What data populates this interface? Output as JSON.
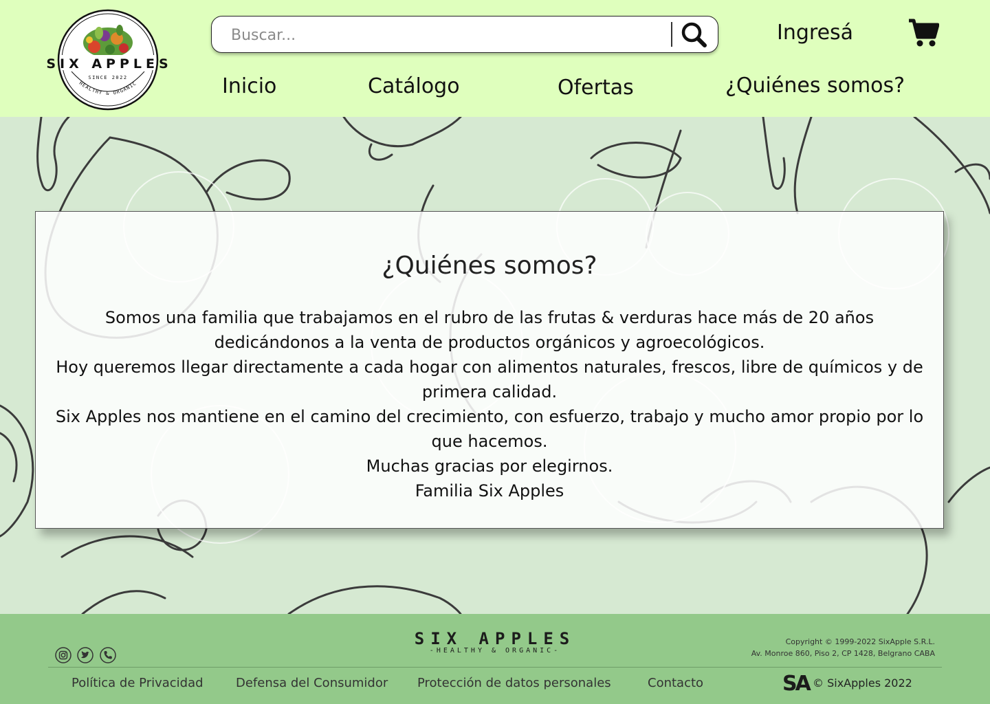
{
  "header": {
    "logo": {
      "brand": "SIX APPLES",
      "since": "SINCE 2022",
      "tagline": "HEALTHY & ORGANIC",
      "icon": "vegetables-basket-logo"
    },
    "search": {
      "placeholder": "Buscar...",
      "value": "",
      "icon": "search-icon"
    },
    "login_label": "Ingresá",
    "cart_icon": "cart-icon",
    "nav": [
      "Inicio",
      "Catálogo",
      "Ofertas",
      "¿Quiénes somos?"
    ]
  },
  "main": {
    "title": "¿Quiénes somos?",
    "paragraphs": [
      "Somos una familia que trabajamos en el rubro de las frutas & verduras hace más de 20 años",
      "dedicándonos a la venta de productos orgánicos y agroecológicos.",
      "Hoy queremos llegar directamente a cada hogar con alimentos naturales, frescos, libre de químicos y de",
      "primera calidad.",
      "Six Apples nos mantiene en el camino del crecimiento, con esfuerzo, trabajo y mucho amor propio por lo",
      "que hacemos.",
      "Muchas gracias por elegirnos.",
      "Familia Six Apples"
    ]
  },
  "footer": {
    "social": [
      "instagram-icon",
      "twitter-icon",
      "phone-icon"
    ],
    "brand": "SIX APPLES",
    "tagline": "-HEALTHY & ORGANIC-",
    "copyright_line1": "Copyright © 1999-2022 SixApple S.R.L.",
    "copyright_line2": "Av. Monroe 860, Piso 2, CP 1428, Belgrano CABA",
    "links": [
      "Política de Privacidad",
      "Defensa del Consumidor",
      "Protección de datos personales",
      "Contacto"
    ],
    "sa_mark": "SA",
    "sa_copyright": "© SixApples 2022"
  },
  "colors": {
    "header_bg": "#dfffbd",
    "page_bg": "#d6e9d2",
    "footer_bg": "#93c98a"
  }
}
